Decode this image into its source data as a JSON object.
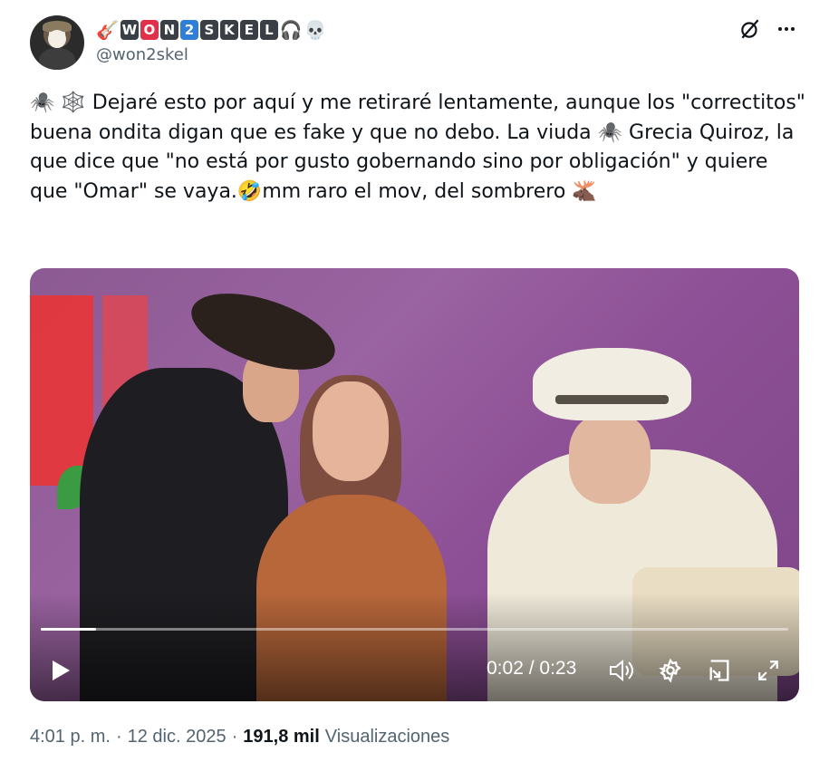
{
  "author": {
    "display_name_prefix_emoji": "🎸",
    "display_name_letters": [
      "W",
      "O",
      "N",
      "2",
      "S",
      "K",
      "E",
      "L"
    ],
    "display_name_suffix_emoji": [
      "🎧",
      "💀"
    ],
    "handle": "@won2skel"
  },
  "header_icons": {
    "grok": "grok-slash-circle-icon",
    "more": "more-dots-icon"
  },
  "post": {
    "text": "🕷️ 🕸️ Dejaré esto por aquí  y me retiraré  lentamente, aunque los \"correctitos\" buena ondita digan que es fake  y que no debo. La viuda 🕷️ Grecia Quiroz, la que dice que \"no está  por gusto  gobernando sino por obligación\" y quiere que \"Omar\" se vaya.🤣mm raro el mov, del sombrero 🫎"
  },
  "video": {
    "progress_fraction": 0.074,
    "current_time": "0:02",
    "separator": " / ",
    "duration": "0:23",
    "controls": [
      "play-icon",
      "volume-icon",
      "settings-gear-icon",
      "picture-in-picture-icon",
      "fullscreen-expand-icon"
    ]
  },
  "footer": {
    "time": "4:01 p. m.",
    "dot1": "·",
    "date": "12 dic. 2025",
    "dot2": "·",
    "views_count": "191,8 mil",
    "views_label": "Visualizaciones"
  },
  "colors": {
    "text": "#0f1419",
    "secondary": "#536471",
    "badge_dark": "#3a3f45",
    "badge_red": "#e0304a",
    "badge_blue": "#2f7fd6"
  }
}
